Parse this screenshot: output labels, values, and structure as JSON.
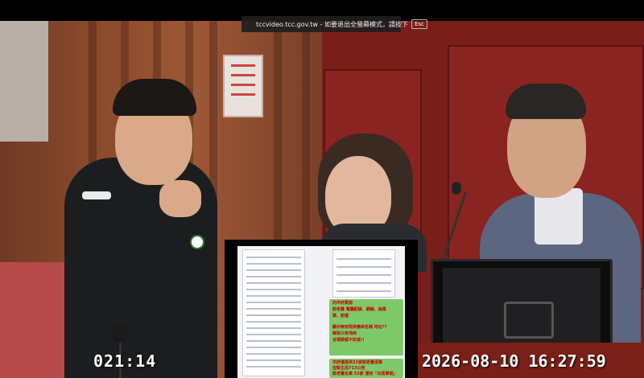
{
  "fullscreen_notice": {
    "message": "tccvideo.tcc.gov.tw - 如要退出全螢幕模式，請按下",
    "key_label": "Esc"
  },
  "overlay": {
    "elapsed_time": "021:14",
    "datetime": "2026-08-10 16:27:59"
  },
  "document": {
    "note_1": "向市府質詢",
    "note_2": "餘老舊 電纜配線、網線、抽風",
    "note_3": "菜、廚僮",
    "note_4": "顯示無有限供應商名稱 地址??",
    "note_5": "懸殊只有地商",
    "note_6": "合場要都不知道!!",
    "note_7": "市府僅提供33家餘老舊清單",
    "note_8": "但衛生局713公告",
    "note_9": "餘老舊名單 53家 僅有「出貨單號」"
  },
  "colors": {
    "chamber_red": "#7a1e1a",
    "wood_brown": "#8b4a2c",
    "note_red": "#c80000",
    "highlight_green": "#7dc96a"
  }
}
